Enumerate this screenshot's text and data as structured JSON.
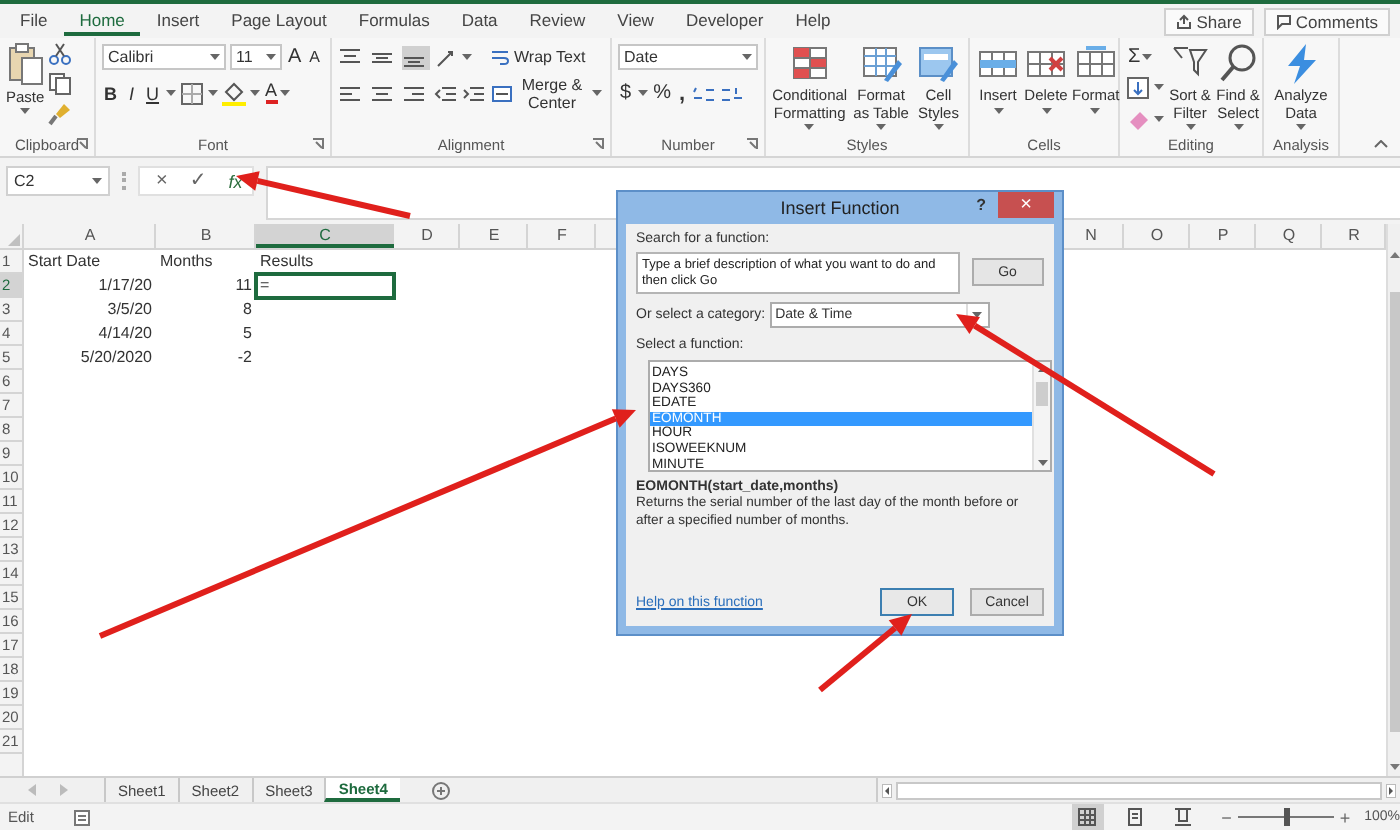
{
  "ribbon_tabs": [
    {
      "label": "File",
      "selected": false
    },
    {
      "label": "Home",
      "selected": true
    },
    {
      "label": "Insert",
      "selected": false
    },
    {
      "label": "Page Layout",
      "selected": false
    },
    {
      "label": "Formulas",
      "selected": false
    },
    {
      "label": "Data",
      "selected": false
    },
    {
      "label": "Review",
      "selected": false
    },
    {
      "label": "View",
      "selected": false
    },
    {
      "label": "Developer",
      "selected": false
    },
    {
      "label": "Help",
      "selected": false
    }
  ],
  "share_button": "Share",
  "comments_button": "Comments",
  "ribbon_groups": [
    {
      "label": "Clipboard",
      "kind": "clipboard",
      "paste": "Paste"
    },
    {
      "label": "Font",
      "kind": "font",
      "font_name": "Calibri",
      "font_size": "11",
      "grow": "A",
      "shrink": "A",
      "bold": "B",
      "italic": "I",
      "underline": "U",
      "font_color": "A"
    },
    {
      "label": "Alignment",
      "kind": "alignment",
      "align_buttons": [
        {
          "selected": false
        },
        {
          "selected": false
        },
        {
          "selected": true
        }
      ],
      "wrap_text": "Wrap Text",
      "merge": "Merge & Center"
    },
    {
      "label": "Number",
      "kind": "number",
      "format": "Date",
      "currency": "$",
      "percent": "%",
      "comma": ","
    },
    {
      "label": "Styles",
      "kind": "large",
      "buttons": [
        "Conditional Formatting",
        "Format as Table",
        "Cell Styles"
      ]
    },
    {
      "label": "Cells",
      "kind": "large",
      "buttons": [
        "Insert",
        "Delete",
        "Format"
      ]
    },
    {
      "label": "Editing",
      "kind": "editing",
      "sum": "Σ",
      "buttons": [
        "Sort & Filter",
        "Find & Select"
      ]
    },
    {
      "label": "Analysis",
      "kind": "large",
      "buttons": [
        "Analyze Data"
      ]
    }
  ],
  "formula_bar": {
    "name_box": "C2",
    "cancel": "×",
    "enter": "✓",
    "function": "fx"
  },
  "sheet": {
    "columns": [
      "A",
      "B",
      "C",
      "D",
      "E",
      "F"
    ],
    "columns_right": [
      "N",
      "O",
      "P",
      "Q",
      "R"
    ],
    "rows": [
      {
        "number": "1",
        "cells": [
          {
            "text": "Start Date",
            "kind": "text",
            "selected": false
          },
          {
            "text": "Months",
            "kind": "text",
            "selected": false
          },
          {
            "text": "Results",
            "kind": "text",
            "selected": false
          }
        ]
      },
      {
        "number": "2",
        "cells": [
          {
            "text": "1/17/20",
            "kind": "number",
            "selected": false
          },
          {
            "text": "11",
            "kind": "number",
            "selected": false
          },
          {
            "text": "=",
            "kind": "text",
            "selected": true
          }
        ]
      },
      {
        "number": "3",
        "cells": [
          {
            "text": "3/5/20",
            "kind": "number",
            "selected": false
          },
          {
            "text": "8",
            "kind": "number",
            "selected": false
          }
        ]
      },
      {
        "number": "4",
        "cells": [
          {
            "text": "4/14/20",
            "kind": "number",
            "selected": false
          },
          {
            "text": "5",
            "kind": "number",
            "selected": false
          }
        ]
      },
      {
        "number": "5",
        "cells": [
          {
            "text": "5/20/2020",
            "kind": "number",
            "selected": false
          },
          {
            "text": "-2",
            "kind": "number",
            "selected": false
          }
        ]
      },
      {
        "number": "6"
      },
      {
        "number": "7"
      },
      {
        "number": "8"
      },
      {
        "number": "9"
      },
      {
        "number": "10"
      },
      {
        "number": "11"
      },
      {
        "number": "12"
      },
      {
        "number": "13"
      },
      {
        "number": "14"
      },
      {
        "number": "15"
      },
      {
        "number": "16"
      },
      {
        "number": "17"
      },
      {
        "number": "18"
      },
      {
        "number": "19"
      },
      {
        "number": "20"
      },
      {
        "number": "21"
      }
    ]
  },
  "dialog": {
    "title": "Insert Function",
    "help": "?",
    "close": "×",
    "search_label": "Search for a function:",
    "search_text": "Type a brief description of what you want to do and then click Go",
    "go_button": "Go",
    "category_label": "Or select a category:",
    "category": "Date & Time",
    "function_label": "Select a function:",
    "functions": [
      {
        "name": "DAYS",
        "selected": false
      },
      {
        "name": "DAYS360",
        "selected": false
      },
      {
        "name": "EDATE",
        "selected": false
      },
      {
        "name": "EOMONTH",
        "selected": true
      },
      {
        "name": "HOUR",
        "selected": false
      },
      {
        "name": "ISOWEEKNUM",
        "selected": false
      },
      {
        "name": "MINUTE",
        "selected": false
      }
    ],
    "signature": "EOMONTH(start_date,months)",
    "description": "Returns the serial number of the last day of the month before or after a specified number of months.",
    "help_link": "Help on this function",
    "ok_button": "OK",
    "cancel_button": "Cancel"
  },
  "sheet_tabs": [
    {
      "label": "Sheet1",
      "selected": false
    },
    {
      "label": "Sheet2",
      "selected": false
    },
    {
      "label": "Sheet3",
      "selected": false
    },
    {
      "label": "Sheet4",
      "selected": true
    }
  ],
  "status_bar": {
    "mode": "Edit",
    "views": [
      {
        "selected": true
      },
      {
        "selected": false
      },
      {
        "selected": false
      }
    ],
    "zoom_out": "−",
    "zoom_in": "+",
    "zoom": {
      "level": 0.5,
      "reading": "100%"
    }
  }
}
